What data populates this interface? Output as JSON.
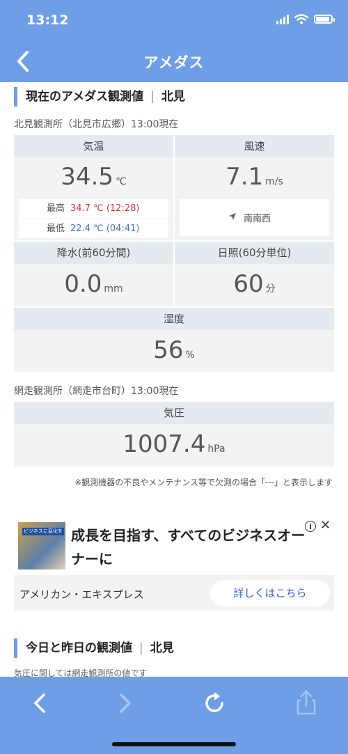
{
  "status_bar": {
    "time": "13:12"
  },
  "header": {
    "title": "アメダス"
  },
  "current": {
    "section_title": "現在のアメダス観測値",
    "location": "北見",
    "station_label": "北見観測所（北見市広郷）13:00現在",
    "temperature": {
      "label": "気温",
      "value": "34.5",
      "unit": "℃",
      "max_label": "最高",
      "max_value": "34.7 ℃ (12:28)",
      "min_label": "最低",
      "min_value": "22.4 ℃ (04:41)"
    },
    "wind": {
      "label": "風速",
      "value": "7.1",
      "unit": "m/s",
      "direction": "南南西",
      "direction_icon": "navigation-arrow-icon"
    },
    "precipitation": {
      "label": "降水(前60分間)",
      "value": "0.0",
      "unit": "mm"
    },
    "sunshine": {
      "label": "日照(60分単位)",
      "value": "60",
      "unit": "分"
    },
    "humidity": {
      "label": "湿度",
      "value": "56",
      "unit": "%"
    },
    "pressure_station_label": "網走観測所（網走市台町）13:00現在",
    "pressure": {
      "label": "気圧",
      "value": "1007.4",
      "unit": "hPa"
    },
    "note": "※観測機器の不良やメンテナンス等で欠測の場合「---」と表示します"
  },
  "ad": {
    "thumb_tag": "ビジネスに変化を",
    "headline": "成長を目指す、すべてのビジネスオーナーに",
    "advertiser": "アメリカン・エキスプレス",
    "cta": "詳しくはこちら",
    "info_label": "i",
    "close_label": "✕"
  },
  "history": {
    "section_title": "今日と昨日の観測値",
    "location": "北見",
    "note": "気圧に関しては網走観測所の値です"
  },
  "colors": {
    "accent": "#6e9fe6",
    "max_temp": "#dd3333",
    "min_temp": "#4a74c9",
    "cta": "#2c63c9"
  }
}
